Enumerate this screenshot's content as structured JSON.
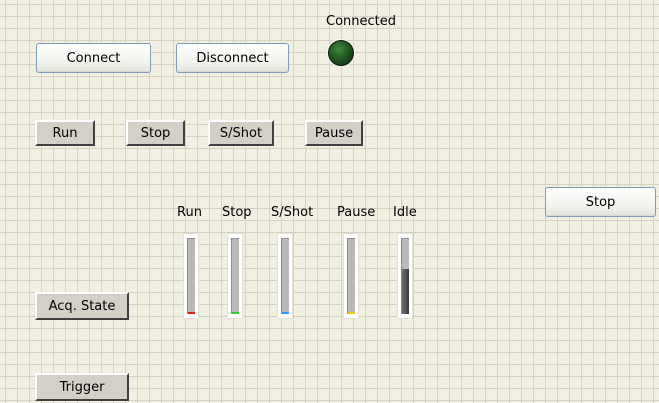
{
  "status": {
    "connected_label": "Connected",
    "connected_value": 0
  },
  "connection": {
    "connect_label": "Connect",
    "disconnect_label": "Disconnect"
  },
  "controls": {
    "run_label": "Run",
    "stop_label": "Stop",
    "sshot_label": "S/Shot",
    "pause_label": "Pause",
    "stop_main_label": "Stop",
    "acq_state_label": "Acq. State",
    "trigger_label": "Trigger"
  },
  "state_meters": [
    {
      "label": "Run",
      "value": 0,
      "color": "#e02020"
    },
    {
      "label": "Stop",
      "value": 0,
      "color": "#33cc33"
    },
    {
      "label": "S/Shot",
      "value": 0,
      "color": "#3399ff"
    },
    {
      "label": "Pause",
      "value": 0,
      "color": "#e6d21a"
    },
    {
      "label": "Idle",
      "value": 0.6,
      "color": "#3a3a3a"
    }
  ]
}
